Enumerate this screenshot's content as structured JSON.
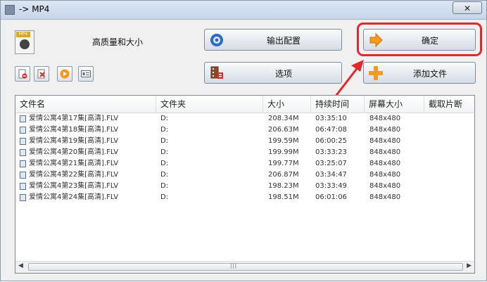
{
  "window": {
    "title": "-> MP4",
    "close_glyph": "✕"
  },
  "left_panel": {
    "quality_label": "高质量和大小",
    "mp4_badge": "MP4"
  },
  "buttons": {
    "output_config": "输出配置",
    "confirm": "确定",
    "options": "选项",
    "add_file": "添加文件"
  },
  "colors": {
    "highlight": "#e0282f",
    "accent_orange": "#f39a1f"
  },
  "table": {
    "columns": [
      "文件名",
      "文件夹",
      "大小",
      "持续时间",
      "屏幕大小",
      "截取片断"
    ],
    "rows": [
      {
        "name": "爱情公寓4第17集[高清].FLV",
        "folder": "D:",
        "size": "208.34M",
        "duration": "03:35:10",
        "screen": "848x480"
      },
      {
        "name": "爱情公寓4第18集[高清].FLV",
        "folder": "D:",
        "size": "206.63M",
        "duration": "06:47:08",
        "screen": "848x480"
      },
      {
        "name": "爱情公寓4第19集[高清].FLV",
        "folder": "D:",
        "size": "199.59M",
        "duration": "06:00:25",
        "screen": "848x480"
      },
      {
        "name": "爱情公寓4第20集[高清].FLV",
        "folder": "D:",
        "size": "199.99M",
        "duration": "03:33:23",
        "screen": "848x480"
      },
      {
        "name": "爱情公寓4第21集[高清].FLV",
        "folder": "D:",
        "size": "199.77M",
        "duration": "03:25:07",
        "screen": "848x480"
      },
      {
        "name": "爱情公寓4第22集[高清].FLV",
        "folder": "D:",
        "size": "206.87M",
        "duration": "03:34:47",
        "screen": "848x480"
      },
      {
        "name": "爱情公寓4第23集[高清].FLV",
        "folder": "D:",
        "size": "198.23M",
        "duration": "03:33:49",
        "screen": "848x480"
      },
      {
        "name": "爱情公寓4第24集[高清].FLV",
        "folder": "D:",
        "size": "198.51M",
        "duration": "06:01:06",
        "screen": "848x480"
      }
    ]
  },
  "scrollbar": {
    "left_arrow": "◀",
    "right_arrow": "▶",
    "grip": "|||"
  }
}
